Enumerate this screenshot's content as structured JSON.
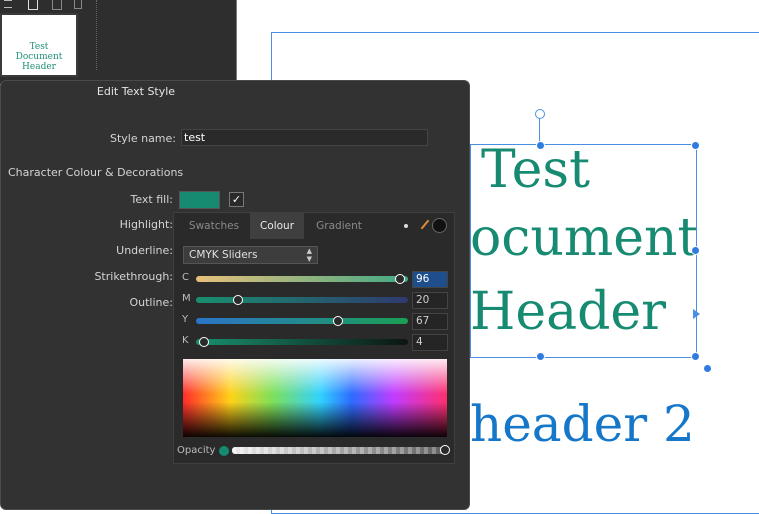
{
  "thumbnail": {
    "lines": [
      "Test",
      "Document",
      "Header"
    ]
  },
  "canvas": {
    "lines": [
      "Test",
      "ocument",
      "Header"
    ],
    "header2": "header 2",
    "text_color": "#178a72",
    "header2_color": "#1677c9"
  },
  "dialog": {
    "title": "Edit Text Style",
    "style_name_label": "Style name:",
    "style_name_value": "test",
    "section_title": "Character Colour & Decorations",
    "text_fill_label": "Text fill:",
    "text_fill_color": "#178a72",
    "text_fill_checked": "✓",
    "highlight_label": "Highlight:",
    "underline_label": "Underline:",
    "strikethrough_label": "Strikethrough:",
    "outline_label": "Outline:"
  },
  "colour_panel": {
    "tabs": [
      "Swatches",
      "Colour",
      "Gradient"
    ],
    "active_tab": "Colour",
    "mode": "CMYK Sliders",
    "sliders": [
      {
        "channel": "C",
        "value": "96",
        "fraction": 0.96
      },
      {
        "channel": "M",
        "value": "20",
        "fraction": 0.2
      },
      {
        "channel": "Y",
        "value": "67",
        "fraction": 0.67
      },
      {
        "channel": "K",
        "value": "4",
        "fraction": 0.04
      }
    ],
    "opacity_label": "Opacity",
    "opacity_fraction": 1.0
  }
}
